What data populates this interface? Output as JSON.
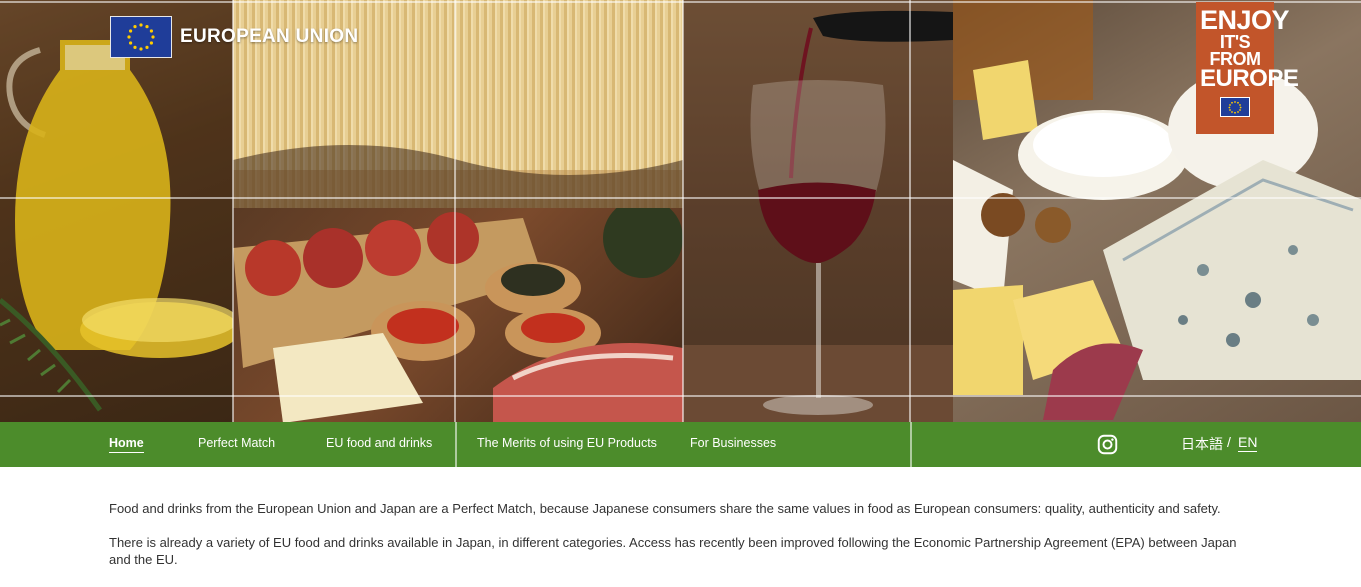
{
  "brand": {
    "logo_text": "EUROPEAN UNION",
    "badge_line1": "ENJOY",
    "badge_line2": "IT'S FROM",
    "badge_line3": "EUROPE"
  },
  "nav": {
    "items": [
      {
        "label": "Home",
        "active": true
      },
      {
        "label": "Perfect Match"
      },
      {
        "label": "EU food and drinks"
      },
      {
        "label": "The Merits of using EU Products"
      },
      {
        "label": "For Businesses"
      }
    ],
    "lang_ja": "日本語",
    "lang_sep": "/",
    "lang_en": "EN"
  },
  "content": {
    "paragraphs": [
      "Food and drinks from the European Union and Japan are a Perfect Match, because Japanese consumers share the same values in food as European consumers: quality, authenticity and safety.",
      "There is already a variety of EU food and drinks available in Japan, in different categories. Access has recently been improved following the Economic Partnership Agreement (EPA) between Japan and the EU."
    ]
  },
  "colors": {
    "nav_bg": "#4c8c2b",
    "eu_blue": "#1f3d99",
    "badge": "#c2552a"
  },
  "icons": [
    "eu-flag-icon",
    "instagram-icon"
  ]
}
